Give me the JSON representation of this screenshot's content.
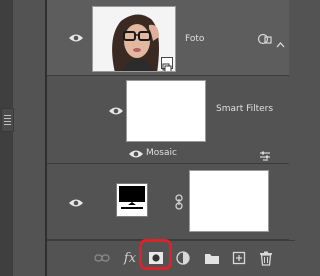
{
  "layers": [
    {
      "name": "Foto",
      "type": "smart-object",
      "visible": true,
      "selected": true
    },
    {
      "name": "Smart Filters",
      "type": "smart-filter-mask",
      "visible": true
    },
    {
      "name": "Mosaic",
      "type": "filter",
      "visible": true
    },
    {
      "name": "",
      "type": "adjustment-with-mask",
      "visible": true
    }
  ],
  "icons": {
    "eye": "eye-icon",
    "filter_options": "filter-options-icon",
    "link": "chain-link-icon",
    "smart_object": "smart-object-icon",
    "collapse": "chevron-up-icon"
  },
  "toolbar": {
    "buttons": [
      "link-layers",
      "fx",
      "add-mask",
      "adjustment",
      "new-group",
      "new-layer",
      "delete"
    ],
    "fx_label": "fx",
    "highlighted": "add-mask"
  },
  "colors": {
    "panel_bg": "#535353",
    "selected_row": "#5d5d5d",
    "highlight": "#d8232a"
  }
}
